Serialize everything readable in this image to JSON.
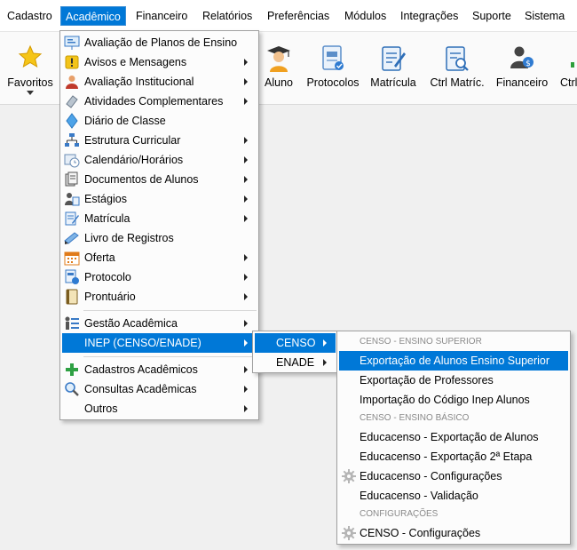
{
  "menubar": {
    "items": [
      "Cadastro",
      "Acadêmico",
      "Financeiro",
      "Relatórios",
      "Preferências",
      "Módulos",
      "Integrações",
      "Suporte",
      "Sistema"
    ],
    "active_index": 1
  },
  "toolbar": {
    "favoritos": "Favoritos",
    "aluno": "Aluno",
    "protocolos": "Protocolos",
    "matricula": "Matrícula",
    "ctrl_matric": "Ctrl Matríc.",
    "financeiro": "Financeiro",
    "ctrl_partial": "Ctrl"
  },
  "menu_academico": {
    "items": [
      "Avaliação de Planos de Ensino",
      "Avisos e Mensagens",
      "Avaliação Institucional",
      "Atividades Complementares",
      "Diário de Classe",
      "Estrutura Curricular",
      "Calendário/Horários",
      "Documentos de Alunos",
      "Estágios",
      "Matrícula",
      "Livro de Registros",
      "Oferta",
      "Protocolo",
      "Prontuário",
      "Gestão Acadêmica",
      "INEP (CENSO/ENADE)",
      "Cadastros Acadêmicos",
      "Consultas Acadêmicas",
      "Outros"
    ]
  },
  "menu_inep": {
    "items": [
      "CENSO",
      "ENADE"
    ]
  },
  "menu_censo": {
    "header_superior": "CENSO - ENSINO SUPERIOR",
    "exportacao_alunos": "Exportação de Alunos Ensino Superior",
    "exportacao_professores": "Exportação de Professores",
    "importacao_codigo": "Importação do Código Inep Alunos",
    "header_basico": "CENSO - ENSINO BÁSICO",
    "educacenso_export_alunos": "Educacenso - Exportação de Alunos",
    "educacenso_export_2etapa": "Educacenso - Exportação 2ª Etapa",
    "educacenso_config": "Educacenso - Configurações",
    "educacenso_validacao": "Educacenso - Validação",
    "header_config": "CONFIGURAÇÕES",
    "censo_config": "CENSO - Configurações"
  },
  "colors": {
    "highlight": "#0078d7",
    "menu_bg": "#fcfcfc",
    "workspace": "#f0f0f0"
  }
}
